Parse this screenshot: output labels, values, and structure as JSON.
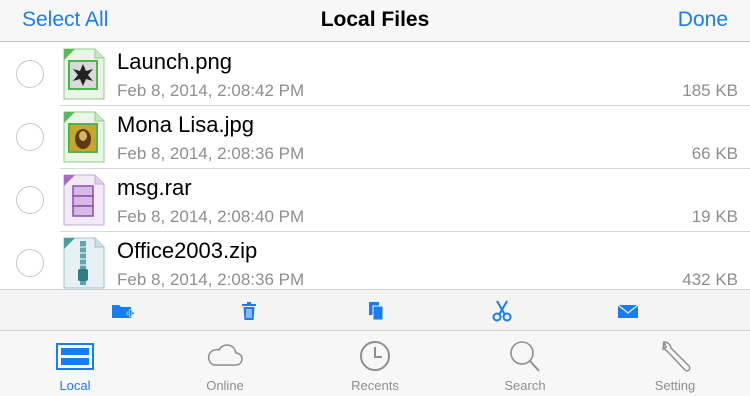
{
  "navbar": {
    "select_all_label": "Select All",
    "title": "Local Files",
    "done_label": "Done"
  },
  "files": [
    {
      "name": "Launch.png",
      "date": "Feb 8, 2014, 2:08:42 PM",
      "size": "185 KB",
      "badge": "PNG",
      "icon": "png-file-icon"
    },
    {
      "name": "Mona Lisa.jpg",
      "date": "Feb 8, 2014, 2:08:36 PM",
      "size": "66 KB",
      "badge": "JPG",
      "icon": "jpg-file-icon"
    },
    {
      "name": "msg.rar",
      "date": "Feb 8, 2014, 2:08:40 PM",
      "size": "19 KB",
      "badge": "RAR",
      "icon": "rar-file-icon"
    },
    {
      "name": "Office2003.zip",
      "date": "Feb 8, 2014, 2:08:36 PM",
      "size": "432 KB",
      "badge": "ZIP",
      "icon": "zip-file-icon"
    }
  ],
  "toolbar": {
    "icons": [
      "new-folder-icon",
      "trash-icon",
      "copy-icon",
      "scissors-icon",
      "mail-icon"
    ]
  },
  "tabs": [
    {
      "label": "Local",
      "icon": "local-storage-icon",
      "active": true
    },
    {
      "label": "Online",
      "icon": "cloud-icon",
      "active": false
    },
    {
      "label": "Recents",
      "icon": "clock-icon",
      "active": false
    },
    {
      "label": "Search",
      "icon": "search-icon",
      "active": false
    },
    {
      "label": "Setting",
      "icon": "wrench-icon",
      "active": false
    }
  ],
  "colors": {
    "accent": "#1a7cf5",
    "secondary_text": "#8e8e93",
    "png_tag": "#5cb85c",
    "rar_tag": "#a56cc1",
    "zip_tag": "#4a9ba8"
  }
}
